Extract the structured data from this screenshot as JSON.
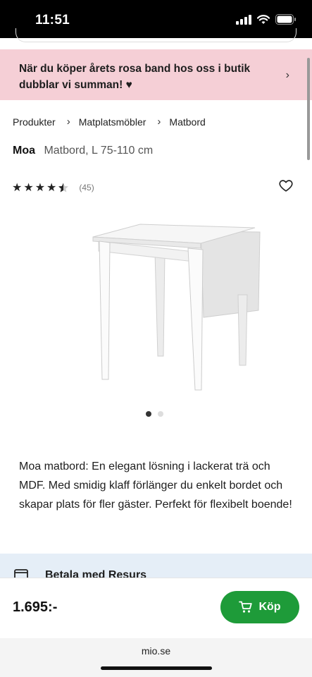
{
  "status_bar": {
    "time": "11:51"
  },
  "promo": {
    "text": "När du köper årets rosa band hos oss i butik dubblar vi summan! ♥",
    "chevron": "›"
  },
  "breadcrumb": {
    "items": [
      "Produkter",
      "Matplatsmöbler",
      "Matbord"
    ],
    "separator": "›"
  },
  "product": {
    "brand": "Moa",
    "subtitle": "Matbord, L 75-110 cm",
    "rating": 4.5,
    "reviews": "(45)",
    "description": "Moa matbord: En elegant lösning i lackerat trä och MDF. Med smidig klaff förlänger du enkelt bordet och skapar plats för fler gäster. Perfekt för flexibelt boende!",
    "gallery": {
      "current": 1,
      "total": 2
    }
  },
  "payment": {
    "label": "Betala med Resurs"
  },
  "purchase": {
    "price": "1.695:-",
    "buy_label": "Köp",
    "accent": "#1e9b39"
  },
  "browser": {
    "url": "mio.se"
  },
  "colors": {
    "promo_bg": "#f5cfd6",
    "resurs_bg": "#e5eef7"
  }
}
